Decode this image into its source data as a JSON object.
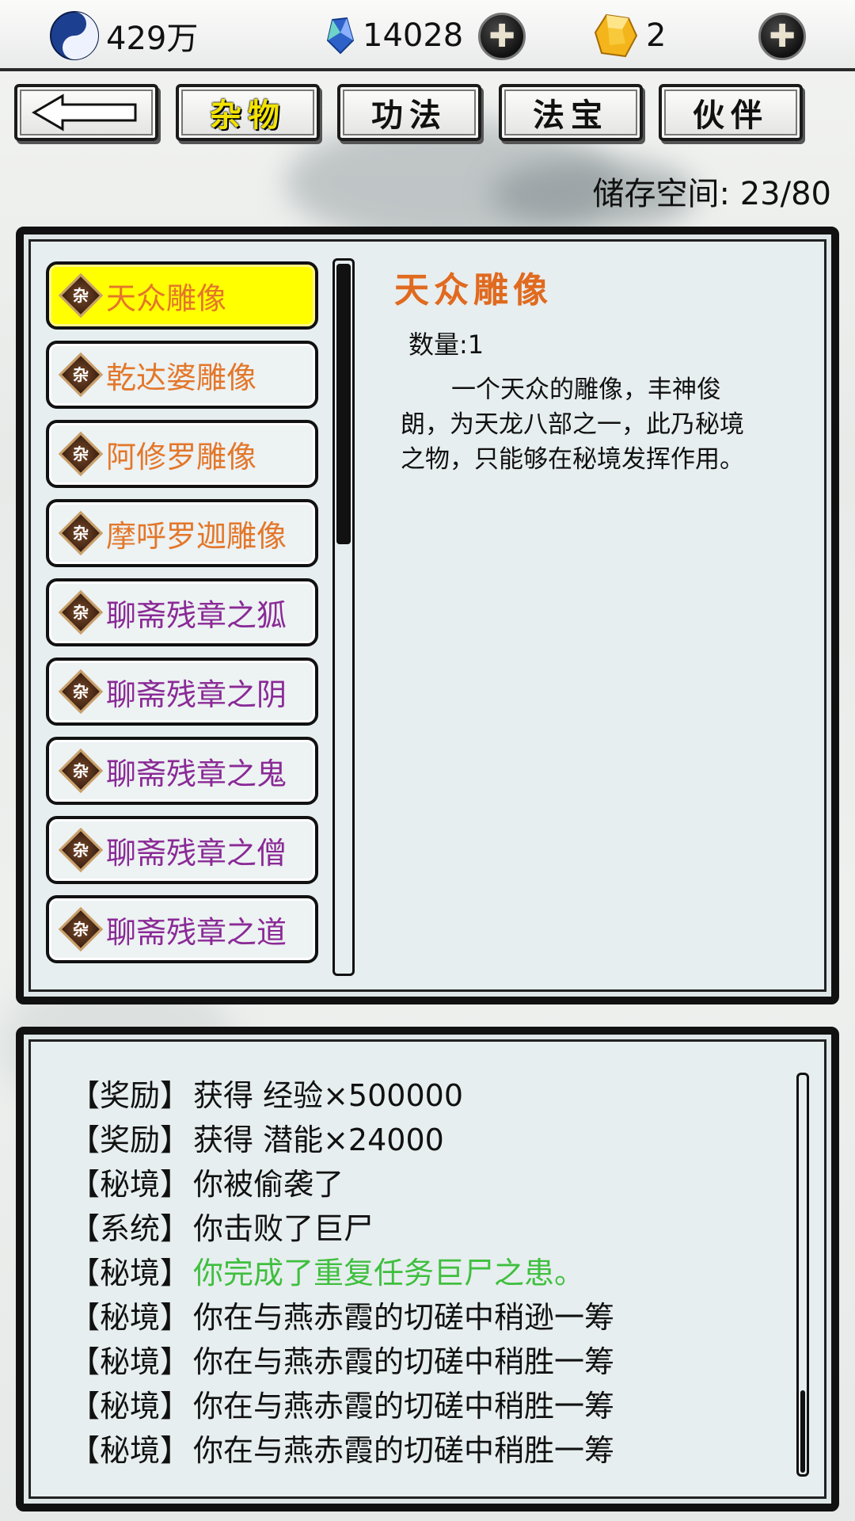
{
  "currency": {
    "silver": {
      "icon": "yin-yang-icon",
      "value": "429万"
    },
    "jade": {
      "icon": "blue-crystal-icon",
      "value": "14028"
    },
    "gold": {
      "icon": "gold-gem-icon",
      "value": "2"
    },
    "add_icon": "✚"
  },
  "tabs": {
    "back_icon": "arrow-left-icon",
    "items": [
      {
        "label": "杂物",
        "active": true
      },
      {
        "label": "功法",
        "active": false
      },
      {
        "label": "法宝",
        "active": false
      },
      {
        "label": "伙伴",
        "active": false
      }
    ]
  },
  "storage": {
    "text": "储存空间: 23/80"
  },
  "inventory": {
    "badge_char": "杂",
    "items": [
      {
        "name": "天众雕像",
        "color": "#e3772a",
        "selected": true
      },
      {
        "name": "乾达婆雕像",
        "color": "#e3772a",
        "selected": false
      },
      {
        "name": "阿修罗雕像",
        "color": "#e3772a",
        "selected": false
      },
      {
        "name": "摩呼罗迦雕像",
        "color": "#e3772a",
        "selected": false
      },
      {
        "name": "聊斋残章之狐",
        "color": "#8a2a96",
        "selected": false
      },
      {
        "name": "聊斋残章之阴",
        "color": "#8a2a96",
        "selected": false
      },
      {
        "name": "聊斋残章之鬼",
        "color": "#8a2a96",
        "selected": false
      },
      {
        "name": "聊斋残章之僧",
        "color": "#8a2a96",
        "selected": false
      },
      {
        "name": "聊斋残章之道",
        "color": "#8a2a96",
        "selected": false
      }
    ]
  },
  "detail": {
    "title": "天众雕像",
    "quantity": "数量:1",
    "description": "一个天众的雕像，丰神俊朗，为天龙八部之一，此乃秘境之物，只能够在秘境发挥作用。"
  },
  "log": {
    "entries": [
      {
        "tag": "【奖励】",
        "text": "获得 经验×500000",
        "color": "#111111"
      },
      {
        "tag": "【奖励】",
        "text": "获得 潜能×24000",
        "color": "#111111"
      },
      {
        "tag": "【秘境】",
        "text": "你被偷袭了",
        "color": "#111111"
      },
      {
        "tag": "【系统】",
        "text": "你击败了巨尸",
        "color": "#111111"
      },
      {
        "tag": "【秘境】",
        "text": "你完成了重复任务巨尸之患。",
        "color": "#3fbf3f"
      },
      {
        "tag": "【秘境】",
        "text": "你在与燕赤霞的切磋中稍逊一筹",
        "color": "#111111"
      },
      {
        "tag": "【秘境】",
        "text": "你在与燕赤霞的切磋中稍胜一筹",
        "color": "#111111"
      },
      {
        "tag": "【秘境】",
        "text": "你在与燕赤霞的切磋中稍胜一筹",
        "color": "#111111"
      },
      {
        "tag": "【秘境】",
        "text": "你在与燕赤霞的切磋中稍胜一筹",
        "color": "#111111"
      }
    ]
  }
}
